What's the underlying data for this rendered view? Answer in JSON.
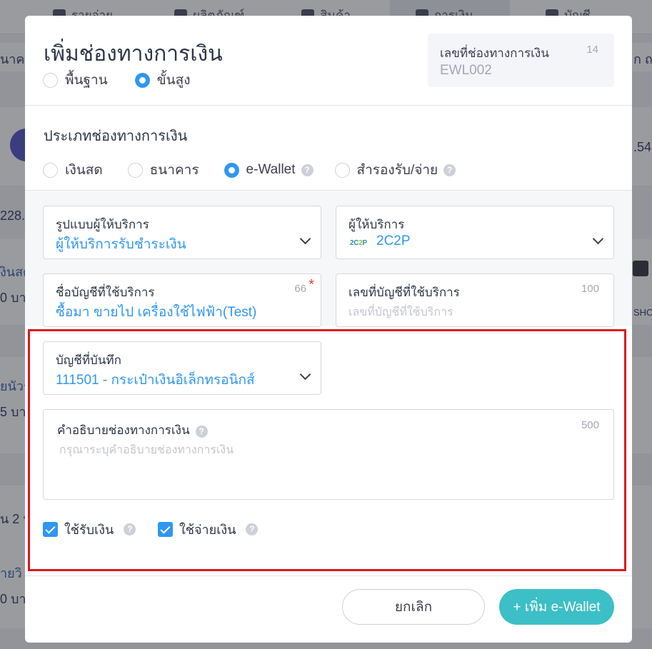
{
  "background": {
    "nav_items": [
      "รายจ่าย",
      "ผลิตภัณฑ์",
      "สินค้า",
      "การเงิน",
      "บัญชี"
    ],
    "left_texts": [
      "นาคา",
      "228.",
      "งินสด",
      "0 บาท",
      "ยนัวร์",
      "5 บาท",
      "น 2 บ",
      "ายวิ",
      "0 บาท"
    ],
    "right_texts": [
      "ก ถ",
      ".54",
      "SHO"
    ]
  },
  "modal": {
    "title": "เพิ่มช่องทางการเงิน",
    "mode_options": [
      {
        "label": "พื้นฐาน",
        "selected": false
      },
      {
        "label": "ขั้นสูง",
        "selected": true
      }
    ],
    "doc_number": {
      "label": "เลขที่ช่องทางการเงิน",
      "counter": "14",
      "value": "EWL002"
    },
    "channel_type": {
      "title": "ประเภทช่องทางการเงิน",
      "options": [
        {
          "label": "เงินสด",
          "selected": false,
          "help": false
        },
        {
          "label": "ธนาคาร",
          "selected": false,
          "help": false
        },
        {
          "label": "e-Wallet",
          "selected": true,
          "help": true
        },
        {
          "label": "สำรองรับ/จ่าย",
          "selected": false,
          "help": true
        }
      ]
    },
    "fields": {
      "provider_type": {
        "label": "รูปแบบผู้ให้บริการ",
        "value": "ผู้ให้บริการรับชำระเงิน"
      },
      "provider": {
        "label": "ผู้ให้บริการ",
        "value": "2C2P",
        "logo_text": "2C2P"
      },
      "account_name": {
        "label": "ชื่อบัญชีที่ใช้บริการ",
        "counter": "66",
        "required_mark": "*",
        "value": "ซื้อมา ขายไป เครื่องใช้ไฟฟ้า(Test)"
      },
      "account_number": {
        "label": "เลขที่บัญชีที่ใช้บริการ",
        "counter": "100",
        "placeholder": "เลขที่บัญชีที่ใช้บริการ"
      },
      "ledger_account": {
        "label": "บัญชีที่บันทึก",
        "value": "111501 - กระเป๋าเงินอิเล็กทรอนิกส์"
      },
      "description": {
        "label": "คำอธิบายช่องทางการเงิน",
        "counter": "500",
        "placeholder": "กรุณาระบุคำอธิบายช่องทางการเงิน"
      }
    },
    "checkboxes": [
      {
        "label": "ใช้รับเงิน",
        "checked": true
      },
      {
        "label": "ใช้จ่ายเงิน",
        "checked": true
      }
    ],
    "buttons": {
      "cancel": "ยกเลิก",
      "submit": "+ เพิ่ม e-Wallet"
    }
  },
  "colors": {
    "accent": "#2f97f0",
    "submit": "#3dbfc7",
    "highlight": "#e0161f",
    "required": "#e8453c"
  }
}
